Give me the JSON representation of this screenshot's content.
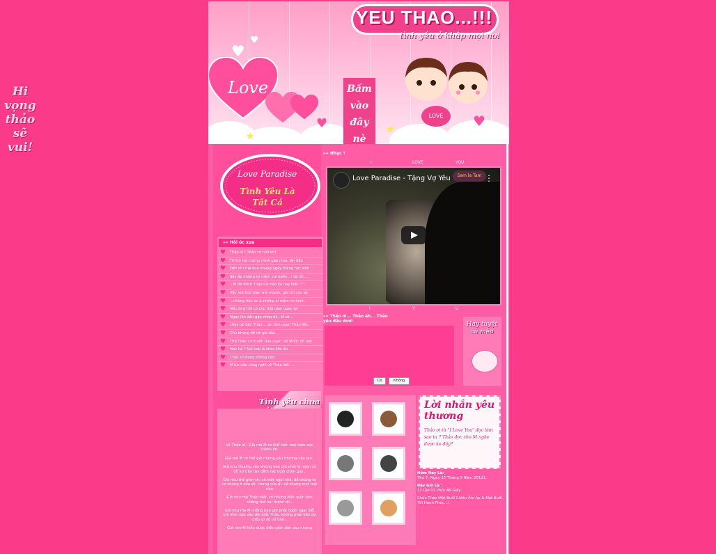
{
  "side_text": "Hi vọng thảo sẽ vui!",
  "header": {
    "title": "YEU THAO...!!!",
    "subtitle": "tình yêu ở khắp mọi nơi",
    "love_word": "Love",
    "click_here": "Bấm vào đây nè",
    "love_tag": "LOVE"
  },
  "love_paradise": {
    "line1": "Love Paradise",
    "line2": "Tình Yêu Là Tất Cả"
  },
  "memories": {
    "heading": "»» Hồi ức xưa",
    "items": [
      "Thảo ơi ! Thảo có nhớ ko?",
      "Từ khi hai chúng mình gặp nhau lần đầu",
      "Đến khi trải qua những ngày tháng học sinh ....",
      "đây ắp những kỷ niệm vui buồn...! Và rồi ....",
      "...M đã thích Thảo lúc nào Ko hay biết ^^",
      "Vậy mà thời gian trôi nhanh, giờ chỉ còn lại",
      "...những tiếc ức & những kí niệm vô hình.",
      "Nếu ông trời có cho thời gian quay lại",
      "Ngay lần đầu gặp nhau đó...M sẽ...",
      "chạy tới bên Thảo ....ân làm quen Thảo liền",
      "Chứ không để tới giờ đâu.",
      "Thế Thảo có muốn làm quen với M lúc đó hok",
      "Hok hả ? Nói hok là khóc liền ấh",
      "Chắc có đúng không nào",
      "M lúc nào cũng nghĩ về Thảo hết ...."
    ]
  },
  "love_unsaid": {
    "title": "Tình yêu chưa nói",
    "paragraphs": [
      "Và Thảo ơi ! Giá mà M có thể biến mọi cảm xúc thành lời,",
      "Giá mà M có thể gửi những yêu thương vào gió..",
      "Giá như thương yêu không bao giờ phải là ngọn cỏ dễ vỡ trên tay dẫm nát dưới chân qua .",
      "Giá như thế gian chỉ có một ngôi nhà, để chúng ta có chung ô cửa sổ, chung cửa đi, về chung một mái nhà",
      "Giá như mà Thảo biết, có những điều giản đơn chẳng thể nói thành lời .",
      "Giá như mà M chẳng bao giờ phải ngồn ngại mỗi khi nhìn sâu vào đôi mắt Thảo, không phải dấu đo điều gì đó về tình .",
      "Giá như M hiểu được điều giản đơn sau những"
    ]
  },
  "music": {
    "heading": "»» Nhạc !",
    "ilu": [
      "I",
      "LOVE",
      "YOU"
    ],
    "iyu": [
      "I",
      "Y",
      "U"
    ],
    "video_title": "Love Paradise - Tặng Vợ Yêu",
    "video_brand": "Sam la Tam"
  },
  "question": {
    "text": "»» Thảo ơi... Thảo ăh... Thảo yêu đầu dưỡi",
    "yes": "Có",
    "no": "Không"
  },
  "cute": {
    "title": "Hay tuyệt cú mèo"
  },
  "message": {
    "title": "Lời nhắn yêu thương",
    "body": "Thảo ơi từ \"I Love You\" đọc làm sao ta ? Thảo đọc cho M nghe được ko đây?"
  },
  "clock": {
    "today_label": "Hôm Nay Là:",
    "today_value": "Thứ 7, Ngày 15 Tháng 5 Năm 20121.",
    "time_label": "Bây Giờ Là :",
    "time_value": "12 Giờ 01 Phút 46 Giây.",
    "greeting": "Chúc Thảo Một Buổi Chiều Ấm Áp & Một Buổi Tối Hạnh Phúc...!"
  },
  "colors": {
    "background": "#fb3a8a",
    "page": "#ff5ca5",
    "accent": "#f0418c",
    "panel": "#ff7bb8"
  },
  "icons": [
    "heart-icon",
    "play-icon",
    "star-icon",
    "more-icon"
  ]
}
